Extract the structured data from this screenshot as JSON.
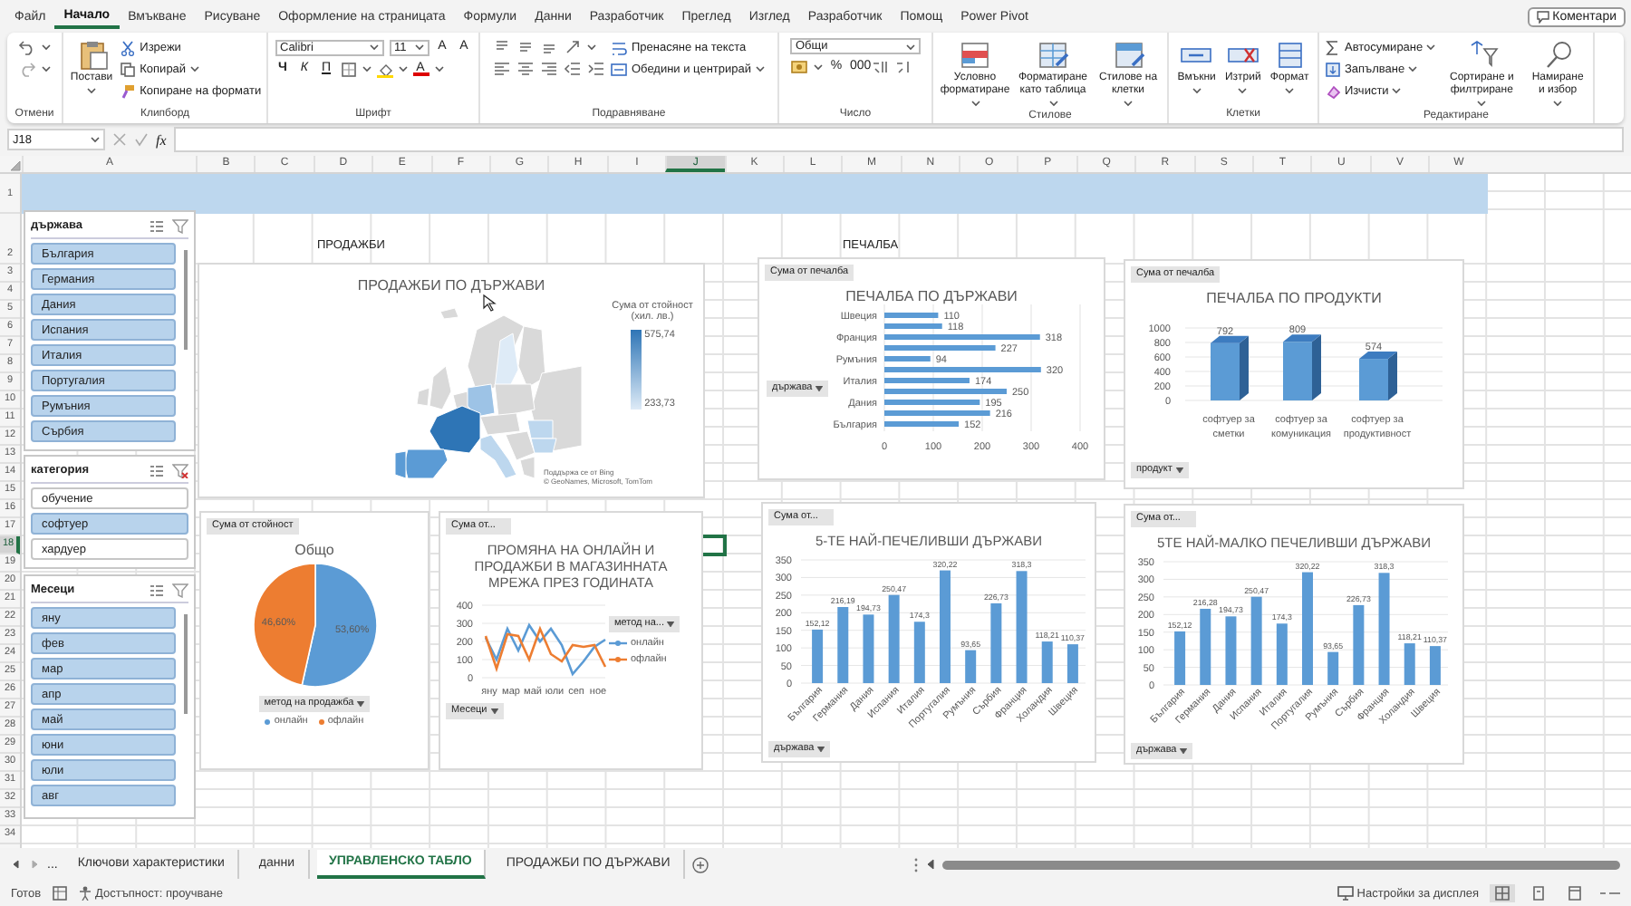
{
  "ribbon": {
    "tabs": [
      {
        "label": "Файл",
        "selected": false
      },
      {
        "label": "Начало",
        "selected": true
      },
      {
        "label": "Вмъкване",
        "selected": false
      },
      {
        "label": "Рисуване",
        "selected": false
      },
      {
        "label": "Оформление на страницата",
        "selected": false
      },
      {
        "label": "Формули",
        "selected": false
      },
      {
        "label": "Данни",
        "selected": false
      },
      {
        "label": "Разработчик",
        "selected": false
      },
      {
        "label": "Преглед",
        "selected": false
      },
      {
        "label": "Изглед",
        "selected": false
      },
      {
        "label": "Разработчик",
        "selected": false
      },
      {
        "label": "Помощ",
        "selected": false
      },
      {
        "label": "Power Pivot",
        "selected": false
      }
    ],
    "comments_button": "Коментари",
    "groups": [
      {
        "kind": "undo",
        "label": "Отмени"
      },
      {
        "kind": "clipboard",
        "label": "Клипборд",
        "paste": "Постави",
        "items": [
          "Изрежи",
          "Копирай",
          "Копиране на формати"
        ]
      },
      {
        "kind": "font",
        "label": "Шрифт",
        "font": "Calibri",
        "size": "11",
        "size_buttons": [
          "A",
          "A"
        ],
        "style_buttons": [
          "Ч",
          "К",
          "П"
        ],
        "color_button": "A"
      },
      {
        "kind": "align",
        "label": "Подравняване",
        "items": [
          "Пренасяне на текста",
          "Обедини и центрирай"
        ]
      },
      {
        "kind": "number",
        "label": "Число",
        "format": "Общи",
        "symbols": [
          "%",
          "000"
        ]
      },
      {
        "kind": "styles",
        "label": "Стилове",
        "items": [
          "Условно форматиране",
          "Форматиране като таблица",
          "Стилове на клетки"
        ]
      },
      {
        "kind": "cells",
        "label": "Клетки",
        "items": [
          "Вмъкни",
          "Изтрий",
          "Формат"
        ]
      },
      {
        "kind": "editing",
        "label": "Редактиране",
        "items": [
          "Автосумиране",
          "Запълване",
          "Изчисти"
        ],
        "large_items": [
          "Сортиране и филтриране",
          "Намиране и избор"
        ]
      }
    ]
  },
  "formula_bar": {
    "name_box": "J18",
    "function_label": "fx"
  },
  "sheet": {
    "columns": [
      {
        "label": "A",
        "selected": false
      },
      {
        "label": "B",
        "selected": false
      },
      {
        "label": "C",
        "selected": false
      },
      {
        "label": "D",
        "selected": false
      },
      {
        "label": "E",
        "selected": false
      },
      {
        "label": "F",
        "selected": false
      },
      {
        "label": "G",
        "selected": false
      },
      {
        "label": "H",
        "selected": false
      },
      {
        "label": "I",
        "selected": false
      },
      {
        "label": "J",
        "selected": true
      },
      {
        "label": "K",
        "selected": false
      },
      {
        "label": "L",
        "selected": false
      },
      {
        "label": "M",
        "selected": false
      },
      {
        "label": "N",
        "selected": false
      },
      {
        "label": "O",
        "selected": false
      },
      {
        "label": "P",
        "selected": false
      },
      {
        "label": "Q",
        "selected": false
      },
      {
        "label": "R",
        "selected": false
      },
      {
        "label": "S",
        "selected": false
      },
      {
        "label": "T",
        "selected": false
      },
      {
        "label": "U",
        "selected": false
      },
      {
        "label": "V",
        "selected": false
      },
      {
        "label": "W",
        "selected": false
      }
    ],
    "rows": [
      {
        "label": "1",
        "selected": false
      },
      {
        "label": "2",
        "selected": false
      },
      {
        "label": "3",
        "selected": false
      },
      {
        "label": "4",
        "selected": false
      },
      {
        "label": "5",
        "selected": false
      },
      {
        "label": "6",
        "selected": false
      },
      {
        "label": "7",
        "selected": false
      },
      {
        "label": "8",
        "selected": false
      },
      {
        "label": "9",
        "selected": false
      },
      {
        "label": "10",
        "selected": false
      },
      {
        "label": "11",
        "selected": false
      },
      {
        "label": "12",
        "selected": false
      },
      {
        "label": "13",
        "selected": false
      },
      {
        "label": "14",
        "selected": false
      },
      {
        "label": "15",
        "selected": false
      },
      {
        "label": "16",
        "selected": false
      },
      {
        "label": "17",
        "selected": false
      },
      {
        "label": "18",
        "selected": true
      },
      {
        "label": "19",
        "selected": false
      },
      {
        "label": "20",
        "selected": false
      },
      {
        "label": "21",
        "selected": false
      },
      {
        "label": "22",
        "selected": false
      },
      {
        "label": "23",
        "selected": false
      },
      {
        "label": "24",
        "selected": false
      },
      {
        "label": "25",
        "selected": false
      },
      {
        "label": "26",
        "selected": false
      },
      {
        "label": "27",
        "selected": false
      },
      {
        "label": "28",
        "selected": false
      },
      {
        "label": "29",
        "selected": false
      },
      {
        "label": "30",
        "selected": false
      },
      {
        "label": "31",
        "selected": false
      },
      {
        "label": "32",
        "selected": false
      },
      {
        "label": "33",
        "selected": false
      },
      {
        "label": "34",
        "selected": false
      }
    ],
    "labels": [
      "ПРОДАЖБИ",
      "ПЕЧАЛБА"
    ],
    "slicers": [
      {
        "title": "държава",
        "items": [
          {
            "label": "България",
            "selected": true
          },
          {
            "label": "Германия",
            "selected": true
          },
          {
            "label": "Дания",
            "selected": true
          },
          {
            "label": "Испания",
            "selected": true
          },
          {
            "label": "Италия",
            "selected": true
          },
          {
            "label": "Португалия",
            "selected": true
          },
          {
            "label": "Румъния",
            "selected": true
          },
          {
            "label": "Сърбия",
            "selected": true
          }
        ]
      },
      {
        "title": "категория",
        "items": [
          {
            "label": "обучение",
            "selected": false
          },
          {
            "label": "софтуер",
            "selected": true
          },
          {
            "label": "хардуер",
            "selected": false
          }
        ]
      },
      {
        "title": "Месеци",
        "items": [
          {
            "label": "яну",
            "selected": true
          },
          {
            "label": "фев",
            "selected": true
          },
          {
            "label": "мар",
            "selected": true
          },
          {
            "label": "апр",
            "selected": true
          },
          {
            "label": "май",
            "selected": true
          },
          {
            "label": "юни",
            "selected": true
          },
          {
            "label": "юли",
            "selected": true
          },
          {
            "label": "авг",
            "selected": true
          }
        ]
      }
    ],
    "charts": [
      {
        "kind": "map",
        "title": "ПРОДАЖБИ ПО ДЪРЖАВИ",
        "legend_title": "Сума от стойност (хил. лв.)",
        "legend_max": "575,74",
        "legend_min": "233,73",
        "credits": [
          "Поддържа се от Bing",
          "© GeoNames, Microsoft, TomTom"
        ]
      },
      {
        "kind": "hbar",
        "field_button": "Сума от печалба",
        "axis_button": "държава",
        "chart_data": {
          "type": "bar",
          "orientation": "horizontal",
          "title": "ПЕЧАЛБА ПО ДЪРЖАВИ",
          "categories": [
            "Швеция",
            null,
            "Франция",
            null,
            "Румъния",
            null,
            "Италия",
            null,
            "Дания",
            null,
            "България"
          ],
          "values": [
            110,
            118,
            318,
            227,
            94,
            320,
            174,
            250,
            195,
            216,
            152
          ],
          "xlim": [
            0,
            400
          ],
          "xticks": [
            0,
            100,
            200,
            300,
            400
          ],
          "grid": true,
          "data_labels": true
        }
      },
      {
        "kind": "column3d",
        "field_button": "Сума от печалба",
        "axis_button": "продукт",
        "chart_data": {
          "type": "bar",
          "title": "ПЕЧАЛБА ПО ПРОДУКТИ",
          "categories": [
            "софтуер за сметки",
            "софтуер за комуникация",
            "софтуер за продуктивност"
          ],
          "values": [
            792,
            809,
            574
          ],
          "ylim": [
            0,
            1000
          ],
          "yticks": [
            0,
            200,
            400,
            600,
            800,
            1000
          ],
          "grid": true,
          "data_labels": true
        }
      },
      {
        "kind": "pie",
        "field_button": "Сума от стойност",
        "legend_button": "метод на продажба",
        "chart_data": {
          "type": "pie",
          "title": "Общо",
          "categories": [
            "онлайн",
            "офлайн"
          ],
          "values": [
            53.6,
            46.6
          ],
          "value_labels": [
            "53,60%",
            "46,60%"
          ]
        }
      },
      {
        "kind": "line",
        "field_button": "Сума от...",
        "legend_button": "метод на...",
        "axis_button": "Месеци",
        "chart_data": {
          "type": "line",
          "title": "ПРОМЯНА НА ОНЛАЙН И ПРОДАЖБИ В МАГАЗИННАТА МРЕЖА ПРЕЗ ГОДИНАТА",
          "categories": [
            "яну",
            null,
            "мар",
            null,
            "май",
            null,
            "юли",
            null,
            "сеп",
            null,
            "ное",
            null
          ],
          "ylim": [
            0,
            400
          ],
          "yticks": [
            0,
            100,
            200,
            300,
            400
          ],
          "grid": true,
          "series": [
            {
              "name": "онлайн",
              "color": "#5b9bd5",
              "values": [
                220,
                100,
                270,
                150,
                290,
                200,
                270,
                180,
                20,
                90,
                170,
                210
              ]
            },
            {
              "name": "офлайн",
              "color": "#ed7d31",
              "values": [
                230,
                50,
                240,
                230,
                100,
                270,
                130,
                90,
                180,
                170,
                180,
                60
              ]
            }
          ]
        }
      },
      {
        "kind": "column",
        "field_button": "Сума от...",
        "axis_button": "държава",
        "chart_data": {
          "type": "bar",
          "title": "5-ТЕ НАЙ-ПЕЧЕЛИВШИ ДЪРЖАВИ",
          "categories": [
            "България",
            "Германия",
            "Дания",
            "Испания",
            "Италия",
            "Португалия",
            "Румъния",
            "Сърбия",
            "Франция",
            "Холандия",
            "Швеция"
          ],
          "values": [
            152.12,
            216.19,
            194.73,
            250.47,
            174.3,
            320.22,
            93.65,
            226.73,
            318.3,
            118.21,
            110.37
          ],
          "value_labels": [
            "152,12",
            "216,19",
            "194,73",
            "250,47",
            "174,3",
            "320,22",
            "93,65",
            "226,73",
            "318,3",
            "118,21",
            "110,37"
          ],
          "ylim": [
            0,
            350
          ],
          "yticks": [
            0,
            50,
            100,
            150,
            200,
            250,
            300,
            350
          ],
          "grid": true
        }
      },
      {
        "kind": "column",
        "field_button": "Сума от...",
        "axis_button": "държава",
        "chart_data": {
          "type": "bar",
          "title": "5ТЕ НАЙ-МАЛКО ПЕЧЕЛИВШИ ДЪРЖАВИ",
          "categories": [
            "България",
            "Германия",
            "Дания",
            "Испания",
            "Италия",
            "Португалия",
            "Румъния",
            "Сърбия",
            "Франция",
            "Холандия",
            "Швеция"
          ],
          "values": [
            152.12,
            216.28,
            194.73,
            250.47,
            174.3,
            320.22,
            93.65,
            226.73,
            318.3,
            118.21,
            110.37
          ],
          "value_labels": [
            "152,12",
            "216,28",
            "194,73",
            "250,47",
            "174,3",
            "320,22",
            "93,65",
            "226,73",
            "318,3",
            "118,21",
            "110,37"
          ],
          "ylim": [
            0,
            350
          ],
          "yticks": [
            0,
            50,
            100,
            150,
            200,
            250,
            300,
            350
          ],
          "grid": true
        }
      }
    ]
  },
  "sheet_tabs": {
    "more": "...",
    "tabs": [
      {
        "label": "Ключови характеристики",
        "selected": false
      },
      {
        "label": "данни",
        "selected": false
      },
      {
        "label": "УПРАВЛЕНСКО ТАБЛО",
        "selected": true
      },
      {
        "label": "ПРОДАЖБИ ПО ДЪРЖАВИ",
        "selected": false
      }
    ]
  },
  "status_bar": {
    "ready": "Готов",
    "accessibility": "Достъпност: проучване",
    "display_settings": "Настройки за дисплея"
  }
}
